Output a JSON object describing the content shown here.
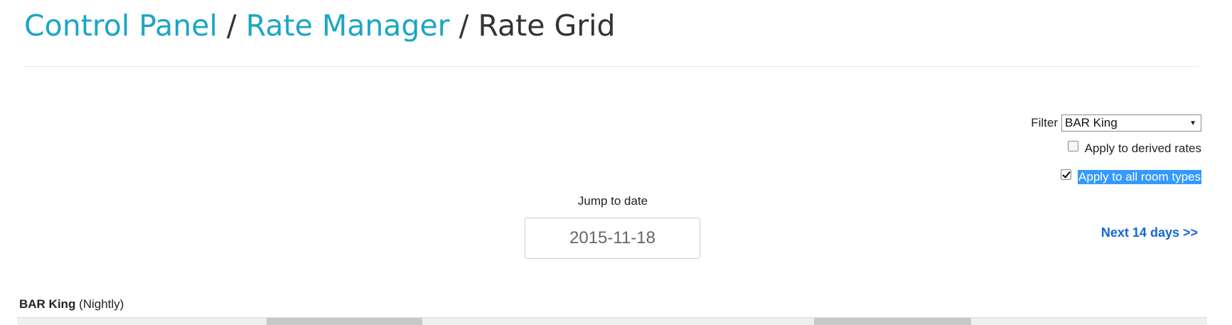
{
  "breadcrumb": {
    "items": [
      "Control Panel",
      "Rate Manager"
    ],
    "separator": "/",
    "current": "Rate Grid"
  },
  "filter": {
    "label": "Filter",
    "selected": "BAR King"
  },
  "options": {
    "derived_label": "Apply to derived rates",
    "derived_checked": false,
    "all_types_label": "Apply to all room types",
    "all_types_checked": true
  },
  "jump": {
    "label": "Jump to date",
    "value": "2015-11-18"
  },
  "nav": {
    "next_label": "Next 14 days >>"
  },
  "rate": {
    "name": "BAR King",
    "period": "(Nightly)"
  },
  "colors": {
    "link": "#1ba6c4",
    "next_link": "#1565d8",
    "selection": "#3399ff"
  }
}
